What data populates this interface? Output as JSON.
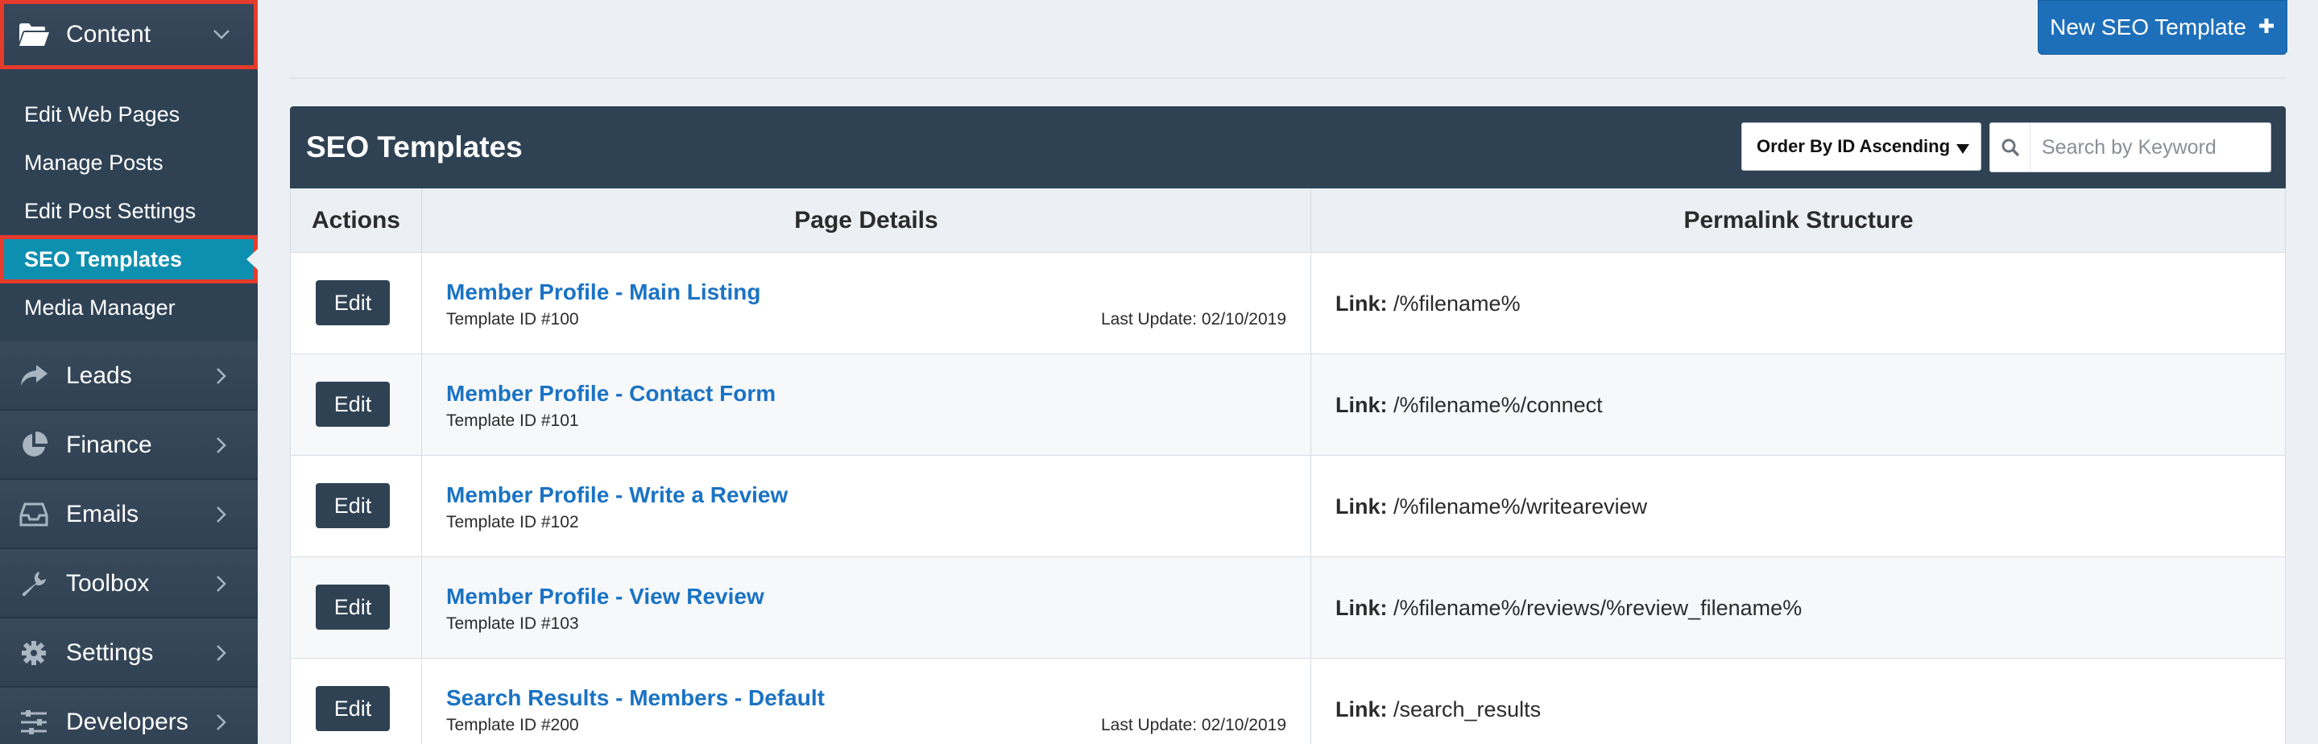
{
  "sidebar": {
    "content_label": "Content",
    "submenu": [
      {
        "label": "Edit Web Pages"
      },
      {
        "label": "Manage Posts"
      },
      {
        "label": "Edit Post Settings"
      },
      {
        "label": "SEO Templates",
        "active": true
      },
      {
        "label": "Media Manager"
      }
    ],
    "sections": [
      {
        "label": "Leads",
        "icon": "share-arrow-icon"
      },
      {
        "label": "Finance",
        "icon": "pie-chart-icon"
      },
      {
        "label": "Emails",
        "icon": "inbox-icon"
      },
      {
        "label": "Toolbox",
        "icon": "wrench-icon"
      },
      {
        "label": "Settings",
        "icon": "gear-icon"
      },
      {
        "label": "Developers",
        "icon": "sliders-icon"
      }
    ]
  },
  "header": {
    "new_button_label": "New SEO Template"
  },
  "panel": {
    "title": "SEO Templates",
    "order_select": "Order By ID Ascending",
    "search_placeholder": "Search by Keyword"
  },
  "table": {
    "columns": [
      "Actions",
      "Page Details",
      "Permalink Structure"
    ],
    "edit_label": "Edit",
    "link_label": "Link:",
    "rows": [
      {
        "name": "Member Profile - Main Listing",
        "id": "Template ID #100",
        "updated": "Last Update: 02/10/2019",
        "link": " /%filename%"
      },
      {
        "name": "Member Profile - Contact Form",
        "id": "Template ID #101",
        "updated": "",
        "link": " /%filename%/connect"
      },
      {
        "name": "Member Profile - Write a Review",
        "id": "Template ID #102",
        "updated": "",
        "link": " /%filename%/writeareview"
      },
      {
        "name": "Member Profile - View Review",
        "id": "Template ID #103",
        "updated": "",
        "link": " /%filename%/reviews/%review_filename%"
      },
      {
        "name": "Search Results - Members - Default",
        "id": "Template ID #200",
        "updated": "Last Update: 02/10/2019",
        "link": " /search_results"
      }
    ]
  },
  "colors": {
    "sidebar_bg": "#2f4254",
    "active_item": "#0d8fb0",
    "highlight_outline": "#e53b2c",
    "primary_button": "#1e6fb9",
    "link_text": "#1a73c4"
  }
}
